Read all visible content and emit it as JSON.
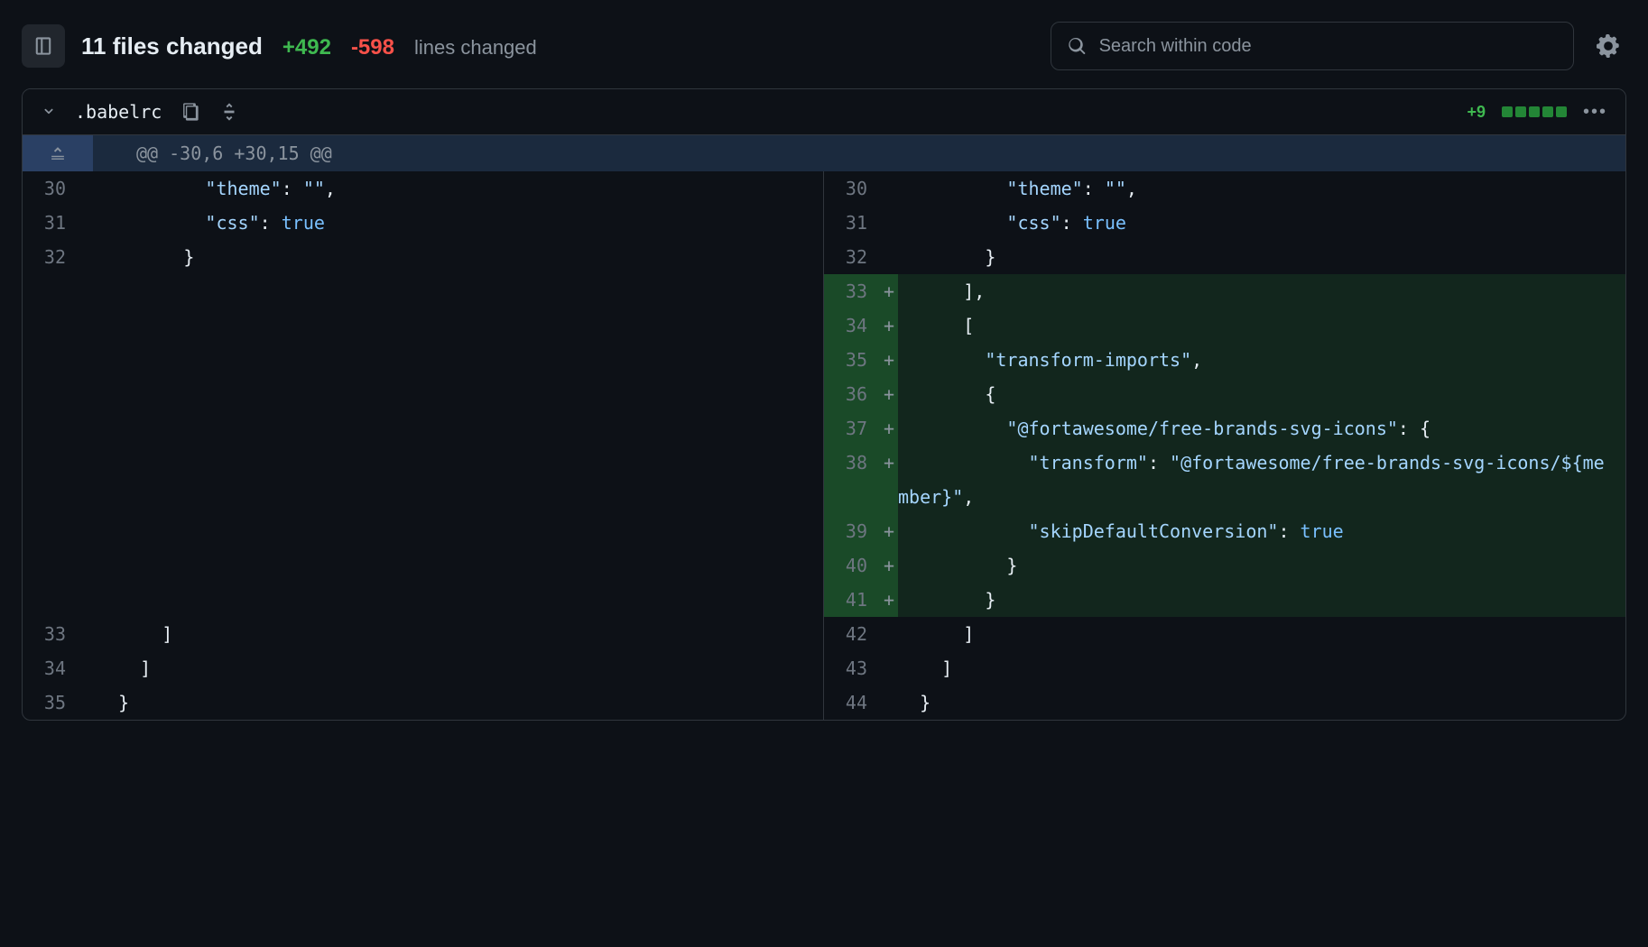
{
  "header": {
    "files_changed": "11 files changed",
    "additions": "+492",
    "deletions": "-598",
    "lines_changed_label": "lines changed",
    "search_placeholder": "Search within code"
  },
  "file": {
    "name": ".babelrc",
    "add_count": "+9"
  },
  "hunk": {
    "header": "@@ -30,6 +30,15 @@"
  },
  "left_rows": [
    {
      "n": "30",
      "m": "",
      "tokens": [
        [
          "p",
          "          "
        ],
        [
          "s",
          "\"theme\""
        ],
        [
          "p",
          ": "
        ],
        [
          "s",
          "\"\""
        ],
        [
          "p",
          ","
        ]
      ]
    },
    {
      "n": "31",
      "m": "",
      "tokens": [
        [
          "p",
          "          "
        ],
        [
          "s",
          "\"css\""
        ],
        [
          "p",
          ": "
        ],
        [
          "b",
          "true"
        ]
      ]
    },
    {
      "n": "32",
      "m": "",
      "tokens": [
        [
          "p",
          "        }"
        ]
      ]
    },
    {
      "n": "",
      "m": "",
      "tokens": []
    },
    {
      "n": "",
      "m": "",
      "tokens": []
    },
    {
      "n": "",
      "m": "",
      "tokens": []
    },
    {
      "n": "",
      "m": "",
      "tokens": []
    },
    {
      "n": "",
      "m": "",
      "tokens": []
    },
    {
      "n": "",
      "m": "",
      "tokens": []
    },
    {
      "n": "",
      "m": "",
      "tokens": []
    },
    {
      "n": "",
      "m": "",
      "tokens": []
    },
    {
      "n": "",
      "m": "",
      "tokens": []
    },
    {
      "n": "",
      "m": "",
      "tokens": []
    },
    {
      "n": "33",
      "m": "",
      "tokens": [
        [
          "p",
          "      ]"
        ]
      ]
    },
    {
      "n": "34",
      "m": "",
      "tokens": [
        [
          "p",
          "    ]"
        ]
      ]
    },
    {
      "n": "35",
      "m": "",
      "tokens": [
        [
          "p",
          "  }"
        ]
      ]
    }
  ],
  "right_rows": [
    {
      "n": "30",
      "m": "",
      "cls": "",
      "tokens": [
        [
          "p",
          "          "
        ],
        [
          "s",
          "\"theme\""
        ],
        [
          "p",
          ": "
        ],
        [
          "s",
          "\"\""
        ],
        [
          "p",
          ","
        ]
      ]
    },
    {
      "n": "31",
      "m": "",
      "cls": "",
      "tokens": [
        [
          "p",
          "          "
        ],
        [
          "s",
          "\"css\""
        ],
        [
          "p",
          ": "
        ],
        [
          "b",
          "true"
        ]
      ]
    },
    {
      "n": "32",
      "m": "",
      "cls": "",
      "tokens": [
        [
          "p",
          "        }"
        ]
      ]
    },
    {
      "n": "33",
      "m": "+",
      "cls": "added",
      "tokens": [
        [
          "p",
          "      ],"
        ]
      ]
    },
    {
      "n": "34",
      "m": "+",
      "cls": "added",
      "tokens": [
        [
          "p",
          "      ["
        ]
      ]
    },
    {
      "n": "35",
      "m": "+",
      "cls": "added",
      "tokens": [
        [
          "p",
          "        "
        ],
        [
          "s",
          "\"transform-imports\""
        ],
        [
          "p",
          ","
        ]
      ]
    },
    {
      "n": "36",
      "m": "+",
      "cls": "added",
      "tokens": [
        [
          "p",
          "        {"
        ]
      ]
    },
    {
      "n": "37",
      "m": "+",
      "cls": "added",
      "tokens": [
        [
          "p",
          "          "
        ],
        [
          "s",
          "\"@fortawesome/free-brands-svg-icons\""
        ],
        [
          "p",
          ": {"
        ]
      ]
    },
    {
      "n": "38",
      "m": "+",
      "cls": "added",
      "tokens": [
        [
          "p",
          "            "
        ],
        [
          "s",
          "\"transform\""
        ],
        [
          "p",
          ": "
        ],
        [
          "s",
          "\"@fortawesome/free-brands-svg-icons/${member}\""
        ],
        [
          "p",
          ","
        ]
      ]
    },
    {
      "n": "39",
      "m": "+",
      "cls": "added",
      "tokens": [
        [
          "p",
          "            "
        ],
        [
          "s",
          "\"skipDefaultConversion\""
        ],
        [
          "p",
          ": "
        ],
        [
          "b",
          "true"
        ]
      ]
    },
    {
      "n": "40",
      "m": "+",
      "cls": "added",
      "tokens": [
        [
          "p",
          "          }"
        ]
      ]
    },
    {
      "n": "41",
      "m": "+",
      "cls": "added",
      "tokens": [
        [
          "p",
          "        }"
        ]
      ]
    },
    {
      "n": "42",
      "m": "",
      "cls": "",
      "tokens": [
        [
          "p",
          "      ]"
        ]
      ]
    },
    {
      "n": "43",
      "m": "",
      "cls": "",
      "tokens": [
        [
          "p",
          "    ]"
        ]
      ]
    },
    {
      "n": "44",
      "m": "",
      "cls": "",
      "tokens": [
        [
          "p",
          "  }"
        ]
      ]
    }
  ]
}
